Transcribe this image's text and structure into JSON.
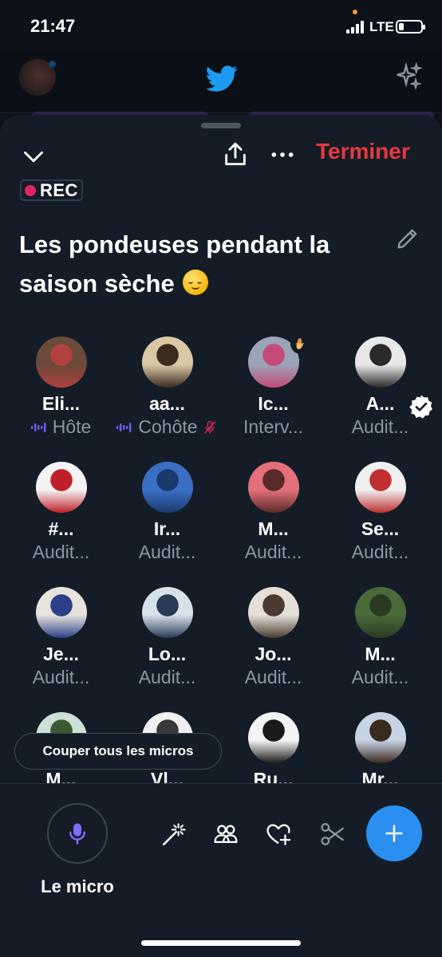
{
  "status_bar": {
    "time": "21:47",
    "network": "LTE"
  },
  "space": {
    "end_label": "Terminer",
    "rec_label": "REC",
    "title": "Les pondeuses pendant la saison sèche",
    "title_emoji": "relieved-face"
  },
  "participants": [
    {
      "name": "Eli...",
      "role": "Hôte",
      "role_icon": "speaking-wave",
      "avatar_colors": [
        "#6b4a3a",
        "#b0413e"
      ]
    },
    {
      "name": "aa...",
      "role": "Cohôte",
      "role_icon": "speaking-wave",
      "trailing_icon": "mic-muted",
      "avatar_colors": [
        "#d9c7a6",
        "#3a2a20"
      ]
    },
    {
      "name": "Ic...",
      "role": "Interv...",
      "badge": "raised-hand",
      "avatar_colors": [
        "#9aa4b8",
        "#c44a7a"
      ]
    },
    {
      "name": "A...",
      "role": "Audit...",
      "badge": "verified",
      "avatar_colors": [
        "#e8e8e8",
        "#2a2a2a"
      ]
    },
    {
      "name": "#...",
      "role": "Audit...",
      "avatar_colors": [
        "#f4f4f4",
        "#c0202a"
      ]
    },
    {
      "name": "Ir...",
      "role": "Audit...",
      "avatar_colors": [
        "#3b6fc4",
        "#1a3a70"
      ]
    },
    {
      "name": "M...",
      "role": "Audit...",
      "avatar_colors": [
        "#e4707a",
        "#5a2a2a"
      ]
    },
    {
      "name": "Se...",
      "role": "Audit...",
      "avatar_colors": [
        "#f0f0f0",
        "#c03030"
      ]
    },
    {
      "name": "Je...",
      "role": "Audit...",
      "avatar_colors": [
        "#e8e2dc",
        "#2c3f8a"
      ]
    },
    {
      "name": "Lo...",
      "role": "Audit...",
      "avatar_colors": [
        "#d8e0e8",
        "#2a3a55"
      ]
    },
    {
      "name": "Jo...",
      "role": "Audit...",
      "avatar_colors": [
        "#e4e0d8",
        "#4a3a30"
      ]
    },
    {
      "name": "M...",
      "role": "Audit...",
      "avatar_colors": [
        "#4a6a3a",
        "#2a3a20"
      ]
    },
    {
      "name": "M...",
      "role": "",
      "avatar_colors": [
        "#cfe0d8",
        "#3a5a30"
      ]
    },
    {
      "name": "Vl...",
      "role": "",
      "avatar_colors": [
        "#f0f0f0",
        "#3a3a3a"
      ]
    },
    {
      "name": "Ru...",
      "role": "",
      "avatar_colors": [
        "#f4f4f4",
        "#1a1a1a"
      ]
    },
    {
      "name": "Mr...",
      "role": "",
      "avatar_colors": [
        "#c8d4e4",
        "#3a2a20"
      ]
    }
  ],
  "toast": {
    "label": "Couper tous les micros"
  },
  "bottom_bar": {
    "mic_label": "Le micro",
    "tools": [
      "magic-wand-icon",
      "people-icon",
      "heart-plus-icon",
      "scissors-icon"
    ],
    "fab_icon": "plus-icon"
  },
  "colors": {
    "end_red": "#e8373f",
    "host_purple": "#6a5cf0",
    "fab_blue": "#2b8ff0",
    "rec_pink": "#e0245e"
  }
}
